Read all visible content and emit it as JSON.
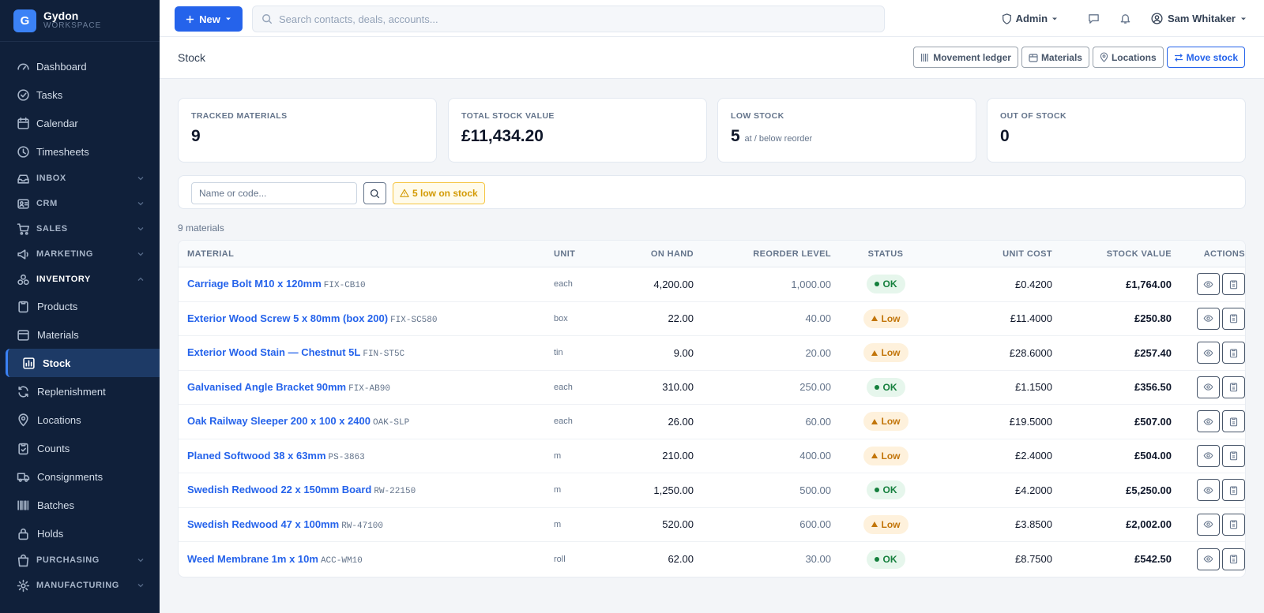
{
  "brand": {
    "initial": "G",
    "name": "Gydon",
    "sub": "WORKSPACE"
  },
  "sidebar": {
    "items": [
      {
        "label": "Dashboard",
        "icon": "dashboard-icon"
      },
      {
        "label": "Tasks",
        "icon": "check-circle-icon"
      },
      {
        "label": "Calendar",
        "icon": "calendar-icon"
      },
      {
        "label": "Timesheets",
        "icon": "clock-icon"
      },
      {
        "label": "INBOX",
        "icon": "inbox-icon"
      },
      {
        "label": "CRM",
        "icon": "contact-card-icon"
      },
      {
        "label": "SALES",
        "icon": "cart-icon"
      },
      {
        "label": "MARKETING",
        "icon": "megaphone-icon"
      },
      {
        "label": "INVENTORY",
        "icon": "boxes-icon"
      },
      {
        "label": "Products",
        "icon": "clipboard-icon"
      },
      {
        "label": "Materials",
        "icon": "box-icon"
      },
      {
        "label": "Stock",
        "icon": "stock-chart-icon"
      },
      {
        "label": "Replenishment",
        "icon": "refresh-icon"
      },
      {
        "label": "Locations",
        "icon": "map-pin-icon"
      },
      {
        "label": "Counts",
        "icon": "clipboard-check-icon"
      },
      {
        "label": "Consignments",
        "icon": "truck-icon"
      },
      {
        "label": "Batches",
        "icon": "barcode-icon"
      },
      {
        "label": "Holds",
        "icon": "lock-icon"
      },
      {
        "label": "PURCHASING",
        "icon": "bag-icon"
      },
      {
        "label": "MANUFACTURING",
        "icon": "gear-icon"
      }
    ]
  },
  "topbar": {
    "new_label": "New",
    "search_placeholder": "Search contacts, deals, accounts...",
    "admin_label": "Admin",
    "user_name": "Sam Whitaker"
  },
  "page": {
    "title": "Stock",
    "actions": [
      "Movement ledger",
      "Materials",
      "Locations",
      "Move stock"
    ]
  },
  "stats": [
    {
      "label": "TRACKED MATERIALS",
      "value": "9",
      "sub": ""
    },
    {
      "label": "TOTAL STOCK VALUE",
      "value": "£11,434.20",
      "sub": ""
    },
    {
      "label": "LOW STOCK",
      "value": "5",
      "sub": "at / below reorder"
    },
    {
      "label": "OUT OF STOCK",
      "value": "0",
      "sub": ""
    }
  ],
  "filter": {
    "placeholder": "Name or code...",
    "low_label": "5 low on stock"
  },
  "count_label": "9 materials",
  "table": {
    "columns": [
      "MATERIAL",
      "UNIT",
      "ON HAND",
      "REORDER LEVEL",
      "STATUS",
      "UNIT COST",
      "STOCK VALUE",
      "ACTIONS"
    ],
    "rows": [
      {
        "name": "Carriage Bolt M10 x 120mm",
        "code": "FIX-CB10",
        "unit": "each",
        "on_hand": "4,200.00",
        "reorder": "1,000.00",
        "status": "OK",
        "cost": "£0.4200",
        "value": "£1,764.00"
      },
      {
        "name": "Exterior Wood Screw 5 x 80mm (box 200)",
        "code": "FIX-SC580",
        "unit": "box",
        "on_hand": "22.00",
        "reorder": "40.00",
        "status": "Low",
        "cost": "£11.4000",
        "value": "£250.80"
      },
      {
        "name": "Exterior Wood Stain — Chestnut 5L",
        "code": "FIN-ST5C",
        "unit": "tin",
        "on_hand": "9.00",
        "reorder": "20.00",
        "status": "Low",
        "cost": "£28.6000",
        "value": "£257.40"
      },
      {
        "name": "Galvanised Angle Bracket 90mm",
        "code": "FIX-AB90",
        "unit": "each",
        "on_hand": "310.00",
        "reorder": "250.00",
        "status": "OK",
        "cost": "£1.1500",
        "value": "£356.50"
      },
      {
        "name": "Oak Railway Sleeper 200 x 100 x 2400",
        "code": "OAK-SLP",
        "unit": "each",
        "on_hand": "26.00",
        "reorder": "60.00",
        "status": "Low",
        "cost": "£19.5000",
        "value": "£507.00"
      },
      {
        "name": "Planed Softwood 38 x 63mm",
        "code": "PS-3863",
        "unit": "m",
        "on_hand": "210.00",
        "reorder": "400.00",
        "status": "Low",
        "cost": "£2.4000",
        "value": "£504.00"
      },
      {
        "name": "Swedish Redwood 22 x 150mm Board",
        "code": "RW-22150",
        "unit": "m",
        "on_hand": "1,250.00",
        "reorder": "500.00",
        "status": "OK",
        "cost": "£4.2000",
        "value": "£5,250.00"
      },
      {
        "name": "Swedish Redwood 47 x 100mm",
        "code": "RW-47100",
        "unit": "m",
        "on_hand": "520.00",
        "reorder": "600.00",
        "status": "Low",
        "cost": "£3.8500",
        "value": "£2,002.00"
      },
      {
        "name": "Weed Membrane 1m x 10m",
        "code": "ACC-WM10",
        "unit": "roll",
        "on_hand": "62.00",
        "reorder": "30.00",
        "status": "OK",
        "cost": "£8.7500",
        "value": "£542.50"
      }
    ]
  },
  "colors": {
    "sidebar_bg": "#10203a",
    "accent": "#2563eb",
    "ok": "#15803d",
    "low": "#c2750a"
  }
}
